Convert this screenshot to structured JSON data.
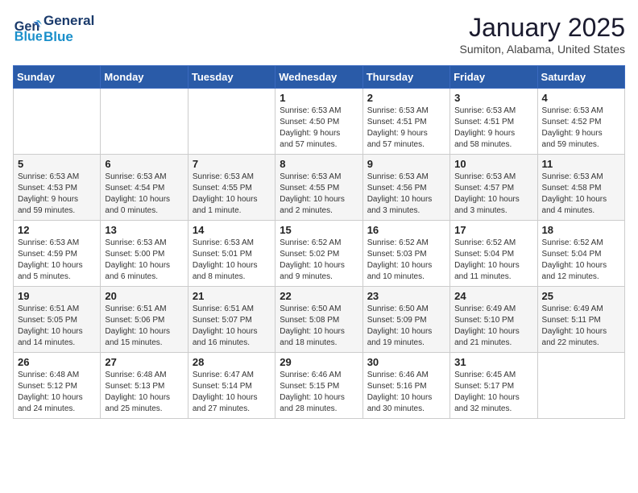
{
  "logo": {
    "line1": "General",
    "line2": "Blue"
  },
  "title": "January 2025",
  "subtitle": "Sumiton, Alabama, United States",
  "weekdays": [
    "Sunday",
    "Monday",
    "Tuesday",
    "Wednesday",
    "Thursday",
    "Friday",
    "Saturday"
  ],
  "weeks": [
    [
      {
        "day": "",
        "info": ""
      },
      {
        "day": "",
        "info": ""
      },
      {
        "day": "",
        "info": ""
      },
      {
        "day": "1",
        "info": "Sunrise: 6:53 AM\nSunset: 4:50 PM\nDaylight: 9 hours\nand 57 minutes."
      },
      {
        "day": "2",
        "info": "Sunrise: 6:53 AM\nSunset: 4:51 PM\nDaylight: 9 hours\nand 57 minutes."
      },
      {
        "day": "3",
        "info": "Sunrise: 6:53 AM\nSunset: 4:51 PM\nDaylight: 9 hours\nand 58 minutes."
      },
      {
        "day": "4",
        "info": "Sunrise: 6:53 AM\nSunset: 4:52 PM\nDaylight: 9 hours\nand 59 minutes."
      }
    ],
    [
      {
        "day": "5",
        "info": "Sunrise: 6:53 AM\nSunset: 4:53 PM\nDaylight: 9 hours\nand 59 minutes."
      },
      {
        "day": "6",
        "info": "Sunrise: 6:53 AM\nSunset: 4:54 PM\nDaylight: 10 hours\nand 0 minutes."
      },
      {
        "day": "7",
        "info": "Sunrise: 6:53 AM\nSunset: 4:55 PM\nDaylight: 10 hours\nand 1 minute."
      },
      {
        "day": "8",
        "info": "Sunrise: 6:53 AM\nSunset: 4:55 PM\nDaylight: 10 hours\nand 2 minutes."
      },
      {
        "day": "9",
        "info": "Sunrise: 6:53 AM\nSunset: 4:56 PM\nDaylight: 10 hours\nand 3 minutes."
      },
      {
        "day": "10",
        "info": "Sunrise: 6:53 AM\nSunset: 4:57 PM\nDaylight: 10 hours\nand 3 minutes."
      },
      {
        "day": "11",
        "info": "Sunrise: 6:53 AM\nSunset: 4:58 PM\nDaylight: 10 hours\nand 4 minutes."
      }
    ],
    [
      {
        "day": "12",
        "info": "Sunrise: 6:53 AM\nSunset: 4:59 PM\nDaylight: 10 hours\nand 5 minutes."
      },
      {
        "day": "13",
        "info": "Sunrise: 6:53 AM\nSunset: 5:00 PM\nDaylight: 10 hours\nand 6 minutes."
      },
      {
        "day": "14",
        "info": "Sunrise: 6:53 AM\nSunset: 5:01 PM\nDaylight: 10 hours\nand 8 minutes."
      },
      {
        "day": "15",
        "info": "Sunrise: 6:52 AM\nSunset: 5:02 PM\nDaylight: 10 hours\nand 9 minutes."
      },
      {
        "day": "16",
        "info": "Sunrise: 6:52 AM\nSunset: 5:03 PM\nDaylight: 10 hours\nand 10 minutes."
      },
      {
        "day": "17",
        "info": "Sunrise: 6:52 AM\nSunset: 5:04 PM\nDaylight: 10 hours\nand 11 minutes."
      },
      {
        "day": "18",
        "info": "Sunrise: 6:52 AM\nSunset: 5:04 PM\nDaylight: 10 hours\nand 12 minutes."
      }
    ],
    [
      {
        "day": "19",
        "info": "Sunrise: 6:51 AM\nSunset: 5:05 PM\nDaylight: 10 hours\nand 14 minutes."
      },
      {
        "day": "20",
        "info": "Sunrise: 6:51 AM\nSunset: 5:06 PM\nDaylight: 10 hours\nand 15 minutes."
      },
      {
        "day": "21",
        "info": "Sunrise: 6:51 AM\nSunset: 5:07 PM\nDaylight: 10 hours\nand 16 minutes."
      },
      {
        "day": "22",
        "info": "Sunrise: 6:50 AM\nSunset: 5:08 PM\nDaylight: 10 hours\nand 18 minutes."
      },
      {
        "day": "23",
        "info": "Sunrise: 6:50 AM\nSunset: 5:09 PM\nDaylight: 10 hours\nand 19 minutes."
      },
      {
        "day": "24",
        "info": "Sunrise: 6:49 AM\nSunset: 5:10 PM\nDaylight: 10 hours\nand 21 minutes."
      },
      {
        "day": "25",
        "info": "Sunrise: 6:49 AM\nSunset: 5:11 PM\nDaylight: 10 hours\nand 22 minutes."
      }
    ],
    [
      {
        "day": "26",
        "info": "Sunrise: 6:48 AM\nSunset: 5:12 PM\nDaylight: 10 hours\nand 24 minutes."
      },
      {
        "day": "27",
        "info": "Sunrise: 6:48 AM\nSunset: 5:13 PM\nDaylight: 10 hours\nand 25 minutes."
      },
      {
        "day": "28",
        "info": "Sunrise: 6:47 AM\nSunset: 5:14 PM\nDaylight: 10 hours\nand 27 minutes."
      },
      {
        "day": "29",
        "info": "Sunrise: 6:46 AM\nSunset: 5:15 PM\nDaylight: 10 hours\nand 28 minutes."
      },
      {
        "day": "30",
        "info": "Sunrise: 6:46 AM\nSunset: 5:16 PM\nDaylight: 10 hours\nand 30 minutes."
      },
      {
        "day": "31",
        "info": "Sunrise: 6:45 AM\nSunset: 5:17 PM\nDaylight: 10 hours\nand 32 minutes."
      },
      {
        "day": "",
        "info": ""
      }
    ]
  ]
}
